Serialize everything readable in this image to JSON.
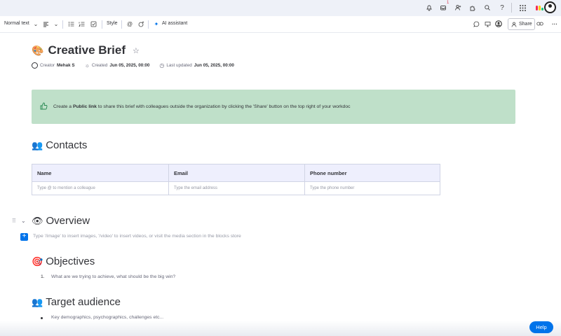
{
  "topbar": {
    "icons": [
      "bell-icon",
      "inbox-icon",
      "invite-members-icon",
      "apps-icon",
      "search-icon",
      "help-icon",
      "grid-menu-icon",
      "monday-logo-icon",
      "user-avatar-icon"
    ],
    "inbox_badge": "1",
    "help_glyph": "?"
  },
  "toolbar": {
    "text_style": "Normal text",
    "style_label": "Style",
    "ai_label": "AI assistant",
    "share_label": "Share"
  },
  "doc": {
    "emoji": "🎨",
    "title": "Creative Brief",
    "creator_label": "Creator",
    "creator_name": "Mehak S",
    "created_label": "Created",
    "created_date": "Jun 05, 2025, 00:00",
    "updated_label": "Last updated",
    "updated_date": "Jun 05, 2025, 00:00"
  },
  "callout": {
    "text_before": "Create a",
    "link_text": "Public link",
    "text_after": "to share this brief with colleagues outside the organization by clicking the 'Share' button on the top right of your workdoc"
  },
  "contacts": {
    "emoji": "👥",
    "heading": "Contacts",
    "columns": [
      "Name",
      "Email",
      "Phone number"
    ],
    "placeholders": [
      "Type @ to mention a colleague",
      "Type the email address",
      "Type the phone number"
    ]
  },
  "overview": {
    "emoji": "👁",
    "heading": "Overview",
    "hint": "Type '/image' to insert images, '/video' to insert videos, or visit the media section in the blocks store"
  },
  "objectives": {
    "emoji": "🎯",
    "heading": "Objectives",
    "item_number": "1.",
    "item_text": "What are we trying to achieve, what should be the big win?"
  },
  "audience": {
    "emoji": "👥",
    "heading": "Target audience",
    "item_text": "Key demographics, psychographics, challenges etc..."
  },
  "help": {
    "label": "Help"
  },
  "colors": {
    "accent": "#0073ea",
    "callout_bg": "#bfe0c9",
    "table_header_bg": "#eeeffd"
  }
}
